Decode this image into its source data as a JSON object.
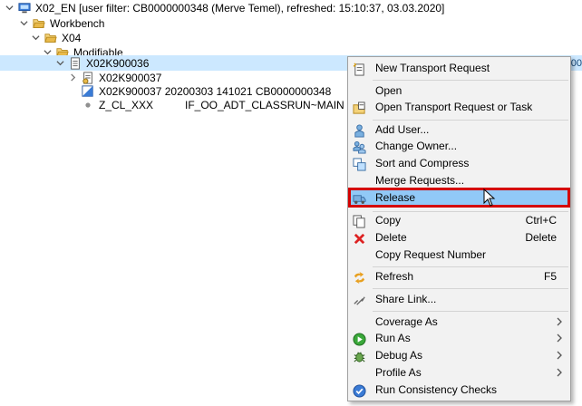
{
  "tree": {
    "root": {
      "label": "X02_EN [user filter: CB0000000348 (Merve Temel), refreshed: 15:10:37, 03.03.2020]"
    },
    "workbench": {
      "label": "Workbench"
    },
    "x04": {
      "label": "X04"
    },
    "modifiable": {
      "label": "Modifiable"
    },
    "request": {
      "label": "X02K900036",
      "edge": "00"
    },
    "task": {
      "label": "X02K900037"
    },
    "task_detail": {
      "label": "X02K900037 20200303 141021 CB0000000348"
    },
    "object": {
      "label": "Z_CL_XXX",
      "label2": "IF_OO_ADT_CLASSRUN~MAIN"
    }
  },
  "context_menu": {
    "items": [
      {
        "label": "New Transport Request",
        "icon": "new-request-icon"
      },
      {
        "label": "Open"
      },
      {
        "label": "Open Transport Request or Task",
        "icon": "open-request-icon"
      },
      {
        "label": "Add User...",
        "icon": "user-icon"
      },
      {
        "label": "Change Owner...",
        "icon": "users-icon"
      },
      {
        "label": "Sort and Compress",
        "icon": "sort-icon"
      },
      {
        "label": "Merge Requests..."
      },
      {
        "label": "Release",
        "icon": "truck-icon",
        "highlighted": true
      },
      {
        "label": "Copy",
        "shortcut": "Ctrl+C",
        "icon": "copy-icon"
      },
      {
        "label": "Delete",
        "shortcut": "Delete",
        "icon": "delete-icon"
      },
      {
        "label": "Copy Request Number"
      },
      {
        "label": "Refresh",
        "shortcut": "F5",
        "icon": "refresh-icon"
      },
      {
        "label": "Share Link...",
        "icon": "link-icon"
      },
      {
        "label": "Coverage As",
        "submenu": true
      },
      {
        "label": "Run As",
        "submenu": true,
        "icon": "run-icon"
      },
      {
        "label": "Debug As",
        "submenu": true,
        "icon": "debug-icon"
      },
      {
        "label": "Profile As",
        "submenu": true
      },
      {
        "label": "Run Consistency Checks",
        "icon": "check-icon"
      }
    ]
  },
  "colors": {
    "selection": "#cce8ff",
    "menu_highlight": "#91c9f7",
    "annotation_frame": "#d40000",
    "folder": "#e8b94a"
  }
}
